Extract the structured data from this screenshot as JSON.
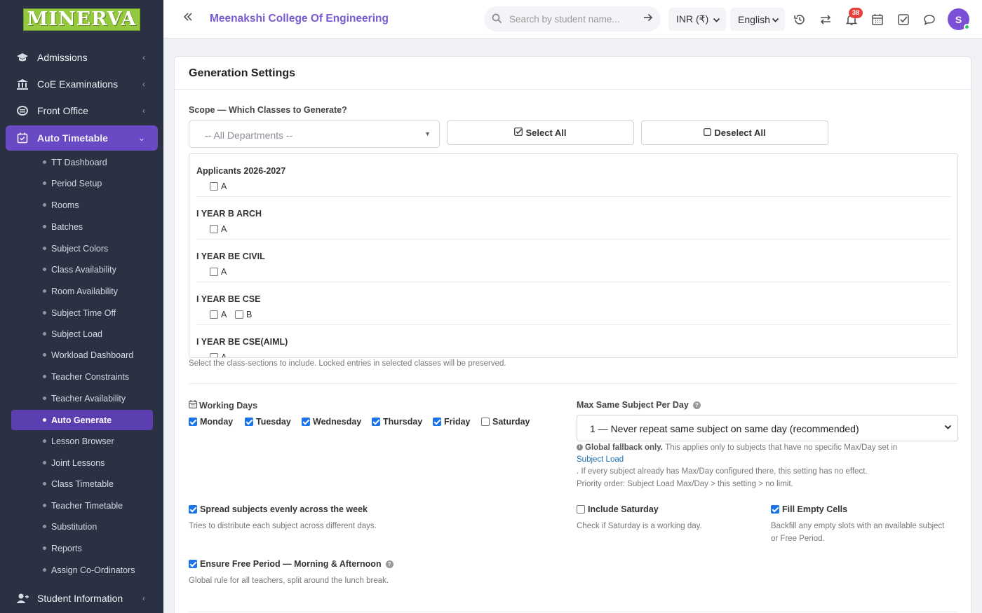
{
  "sidebar": {
    "logo": "MINERVA",
    "items": [
      {
        "label": "Admissions",
        "icon": "graduation-cap-icon"
      },
      {
        "label": "CoE Examinations",
        "icon": "institution-icon"
      },
      {
        "label": "Front Office",
        "icon": "front-office-icon"
      },
      {
        "label": "Auto Timetable",
        "icon": "calendar-check-icon"
      }
    ],
    "subitems": [
      "TT Dashboard",
      "Period Setup",
      "Rooms",
      "Batches",
      "Subject Colors",
      "Class Availability",
      "Room Availability",
      "Subject Time Off",
      "Subject Load",
      "Workload Dashboard",
      "Teacher Constraints",
      "Teacher Availability",
      "Auto Generate",
      "Lesson Browser",
      "Joint Lessons",
      "Class Timetable",
      "Teacher Timetable",
      "Substitution",
      "Reports",
      "Assign Co-Ordinators"
    ],
    "active_subitem": "Auto Generate",
    "bottom_item": {
      "label": "Student Information",
      "icon": "user-plus-icon"
    }
  },
  "topbar": {
    "college": "Meenakshi College Of Engineering",
    "search_placeholder": "Search by student name...",
    "currency": "INR (₹)",
    "language": "English",
    "notification_count": "38",
    "avatar_initial": "S"
  },
  "card": {
    "title": "Generation Settings",
    "scope_label": "Scope — Which Classes to Generate?",
    "dept_select": "-- All Departments --",
    "select_all": "Select All",
    "deselect_all": "Deselect All",
    "groups": [
      {
        "title": "Applicants 2026-2027",
        "sections": [
          "A"
        ]
      },
      {
        "title": "I YEAR B ARCH",
        "sections": [
          "A"
        ]
      },
      {
        "title": "I YEAR BE CIVIL",
        "sections": [
          "A"
        ]
      },
      {
        "title": "I YEAR BE CSE",
        "sections": [
          "A",
          "B"
        ]
      },
      {
        "title": "I YEAR BE CSE(AIML)",
        "sections": [
          "A"
        ]
      }
    ],
    "scope_help": "Select the class-sections to include. Locked entries in selected classes will be preserved.",
    "working_days_label": "Working Days",
    "days": [
      {
        "label": "Monday",
        "checked": true
      },
      {
        "label": "Tuesday",
        "checked": true
      },
      {
        "label": "Wednesday",
        "checked": true
      },
      {
        "label": "Thursday",
        "checked": true
      },
      {
        "label": "Friday",
        "checked": true
      },
      {
        "label": "Saturday",
        "checked": false
      }
    ],
    "max_same_label": "Max Same Subject Per Day",
    "max_same_value": "1 — Never repeat same subject on same day (recommended)",
    "note_strong": "Global fallback only.",
    "note_1": "This applies only to subjects that have no specific Max/Day set in",
    "note_link": "Subject Load",
    "note_2": ". If every subject already has Max/Day configured there, this setting has no effect.",
    "note_3": "Priority order: Subject Load Max/Day > this setting > no limit.",
    "spread_label": "Spread subjects evenly across the week",
    "spread_help": "Tries to distribute each subject across different days.",
    "saturday_label": "Include Saturday",
    "saturday_help": "Check if Saturday is a working day.",
    "fill_label": "Fill Empty Cells",
    "fill_help_1": "Backfill any empty slots with an available subject",
    "fill_help_2": "or Free Period.",
    "free_label": "Ensure Free Period — Morning & Afternoon",
    "free_help": "Global rule for all teachers, split around the lunch break."
  }
}
